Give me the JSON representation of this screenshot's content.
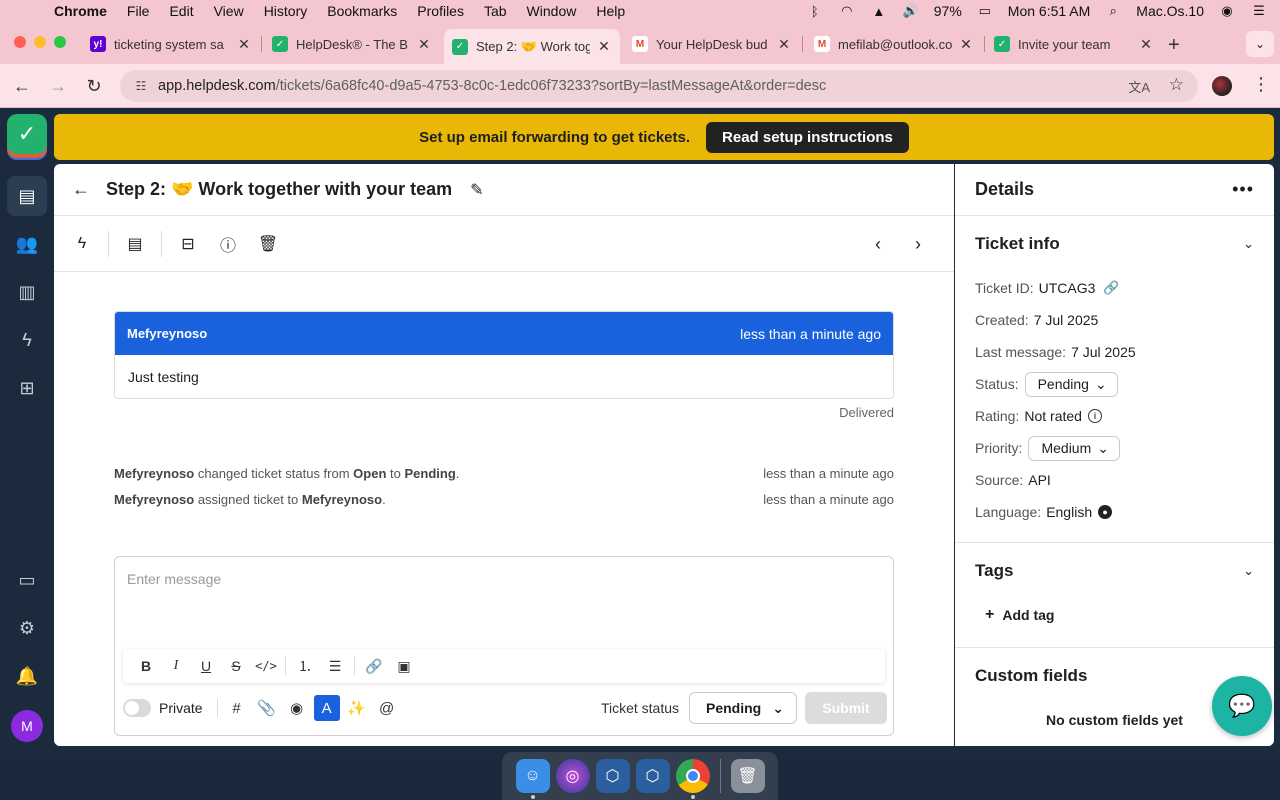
{
  "menubar": {
    "app_name": "Chrome",
    "items": [
      "File",
      "Edit",
      "View",
      "History",
      "Bookmarks",
      "Profiles",
      "Tab",
      "Window",
      "Help"
    ],
    "battery": "97%",
    "clock": "Mon 6:51 AM",
    "user": "Mac.Os.10"
  },
  "tabs": [
    {
      "title": "ticketing system sa",
      "favicon": "yahoo-icon",
      "color": "#6001d2"
    },
    {
      "title": "HelpDesk® - The B",
      "favicon": "helpdesk-icon",
      "color": "#23b26d"
    },
    {
      "title": "Step 2: 🤝 Work tog",
      "favicon": "helpdesk-icon",
      "color": "#23b26d"
    },
    {
      "title": "Your HelpDesk bud",
      "favicon": "gmail-icon",
      "color": "#ea4335"
    },
    {
      "title": "mefilab@outlook.co",
      "favicon": "gmail-icon",
      "color": "#ea4335"
    },
    {
      "title": "Invite your team",
      "favicon": "helpdesk-icon",
      "color": "#23b26d"
    }
  ],
  "address": {
    "host": "app.helpdesk.com",
    "path": "/tickets/6a68fc40-d9a5-4753-8c0c-1edc06f73233?sortBy=lastMessageAt&order=desc"
  },
  "banner": {
    "text": "Set up email forwarding to get tickets.",
    "button": "Read setup instructions"
  },
  "ticket": {
    "title": "Step 2: 🤝 Work together with your team"
  },
  "message": {
    "author": "Mefyreynoso",
    "time": "less than a minute ago",
    "body": "Just testing",
    "delivery": "Delivered"
  },
  "events": [
    {
      "actor": "Mefyreynoso",
      "t1": " changed ticket status from ",
      "b1": "Open",
      "t2": " to ",
      "b2": "Pending",
      "t3": ".",
      "time": "less than a minute ago"
    },
    {
      "actor": "Mefyreynoso",
      "t1": " assigned ticket to ",
      "b1": "Mefyreynoso",
      "t2": ".",
      "b2": "",
      "t3": "",
      "time": "less than a minute ago"
    }
  ],
  "composer": {
    "placeholder": "Enter message",
    "private_label": "Private",
    "ticket_status_label": "Ticket status",
    "status_value": "Pending",
    "submit": "Submit"
  },
  "details": {
    "title": "Details",
    "ticket_info_title": "Ticket info",
    "rows": {
      "id_label": "Ticket ID:",
      "id_value": "UTCAG3",
      "created_label": "Created:",
      "created_value": "7 Jul 2025",
      "last_label": "Last message:",
      "last_value": "7 Jul 2025",
      "status_label": "Status:",
      "status_value": "Pending",
      "rating_label": "Rating:",
      "rating_value": "Not rated",
      "priority_label": "Priority:",
      "priority_value": "Medium",
      "source_label": "Source:",
      "source_value": "API",
      "language_label": "Language:",
      "language_value": "English"
    },
    "tags_title": "Tags",
    "add_tag": "Add tag",
    "custom_fields_title": "Custom fields",
    "no_custom_fields": "No custom fields yet"
  },
  "user_avatar_initial": "M"
}
